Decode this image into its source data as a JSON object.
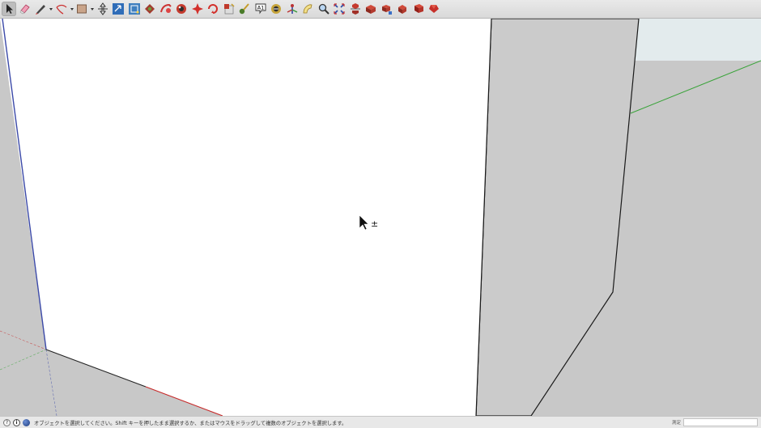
{
  "toolbar": {
    "tools": [
      {
        "name": "select-tool-button",
        "icon": "select-arrow-icon",
        "active": true,
        "menu": false
      },
      {
        "name": "eraser-tool-button",
        "icon": "eraser-icon",
        "active": false,
        "menu": false
      },
      {
        "name": "line-tool-button",
        "icon": "pencil-icon",
        "active": false,
        "menu": true
      },
      {
        "name": "arc-tool-button",
        "icon": "arc-icon",
        "active": false,
        "menu": true
      },
      {
        "name": "shape-tool-button",
        "icon": "rectangle-icon",
        "active": false,
        "menu": true
      },
      {
        "name": "push-pull-tool-button",
        "icon": "push-pull-icon",
        "active": false,
        "menu": false
      },
      {
        "name": "move-tool-button",
        "icon": "move-icon",
        "active": false,
        "menu": false
      },
      {
        "name": "scale-tool-button",
        "icon": "scale-icon",
        "active": false,
        "menu": false
      },
      {
        "name": "rotate-tool-button",
        "icon": "rotate-icon",
        "active": false,
        "menu": false
      },
      {
        "name": "follow-me-tool-button",
        "icon": "follow-me-icon",
        "active": false,
        "menu": false
      },
      {
        "name": "offset-tool-button",
        "icon": "offset-icon",
        "active": false,
        "menu": false
      },
      {
        "name": "tape-measure-tool-button",
        "icon": "tape-measure-icon",
        "active": false,
        "menu": false
      },
      {
        "name": "dimension-tool-button",
        "icon": "dimension-icon",
        "active": false,
        "menu": false
      },
      {
        "name": "protractor-tool-button",
        "icon": "protractor-icon",
        "active": false,
        "menu": false
      },
      {
        "name": "paint-bucket-tool-button",
        "icon": "paint-bucket-icon",
        "active": false,
        "menu": false
      },
      {
        "name": "text-tool-button",
        "icon": "text-icon",
        "active": false,
        "menu": false
      },
      {
        "name": "3d-text-tool-button",
        "icon": "3d-text-icon",
        "active": false,
        "menu": false
      },
      {
        "name": "axes-tool-button",
        "icon": "axes-icon",
        "active": false,
        "menu": false
      },
      {
        "name": "section-plane-tool-button",
        "icon": "section-plane-icon",
        "active": false,
        "menu": false
      },
      {
        "name": "orbit-tool-button",
        "icon": "orbit-icon",
        "active": false,
        "menu": false
      },
      {
        "name": "pan-tool-button",
        "icon": "pan-icon",
        "active": false,
        "menu": false
      },
      {
        "name": "zoom-tool-button",
        "icon": "zoom-icon",
        "active": false,
        "menu": false
      },
      {
        "name": "zoom-extents-tool-button",
        "icon": "zoom-extents-icon",
        "active": false,
        "menu": false
      },
      {
        "name": "3d-warehouse-button",
        "icon": "3d-warehouse-icon",
        "active": false,
        "menu": false
      },
      {
        "name": "share-model-button",
        "icon": "share-model-icon",
        "active": false,
        "menu": false
      },
      {
        "name": "extension-warehouse-button",
        "icon": "extension-warehouse-icon",
        "active": false,
        "menu": false
      },
      {
        "name": "extension-manager-button",
        "icon": "extension-manager-icon",
        "active": false,
        "menu": false
      }
    ]
  },
  "colors": {
    "face_front": "#ffffff",
    "face_side": "#cbcbcb",
    "ground": "#c8c8c8",
    "sky": "#e3ebed",
    "red_axis": "#c62828",
    "green_axis": "#39a339",
    "blue_axis": "#3b49a8",
    "edge": "#1a1a1a"
  },
  "cursor": {
    "icon": "select-add-cursor-icon",
    "modifier_glyph": "±"
  },
  "status": {
    "message": "オブジェクトを選択してください。Shift キーを押したまま選択するか、またはマウスをドラッグして複数のオブジェクトを選択します。",
    "help_glyph": "?",
    "info_glyph": "i",
    "measurements_label": "測定",
    "measurements_value": ""
  }
}
